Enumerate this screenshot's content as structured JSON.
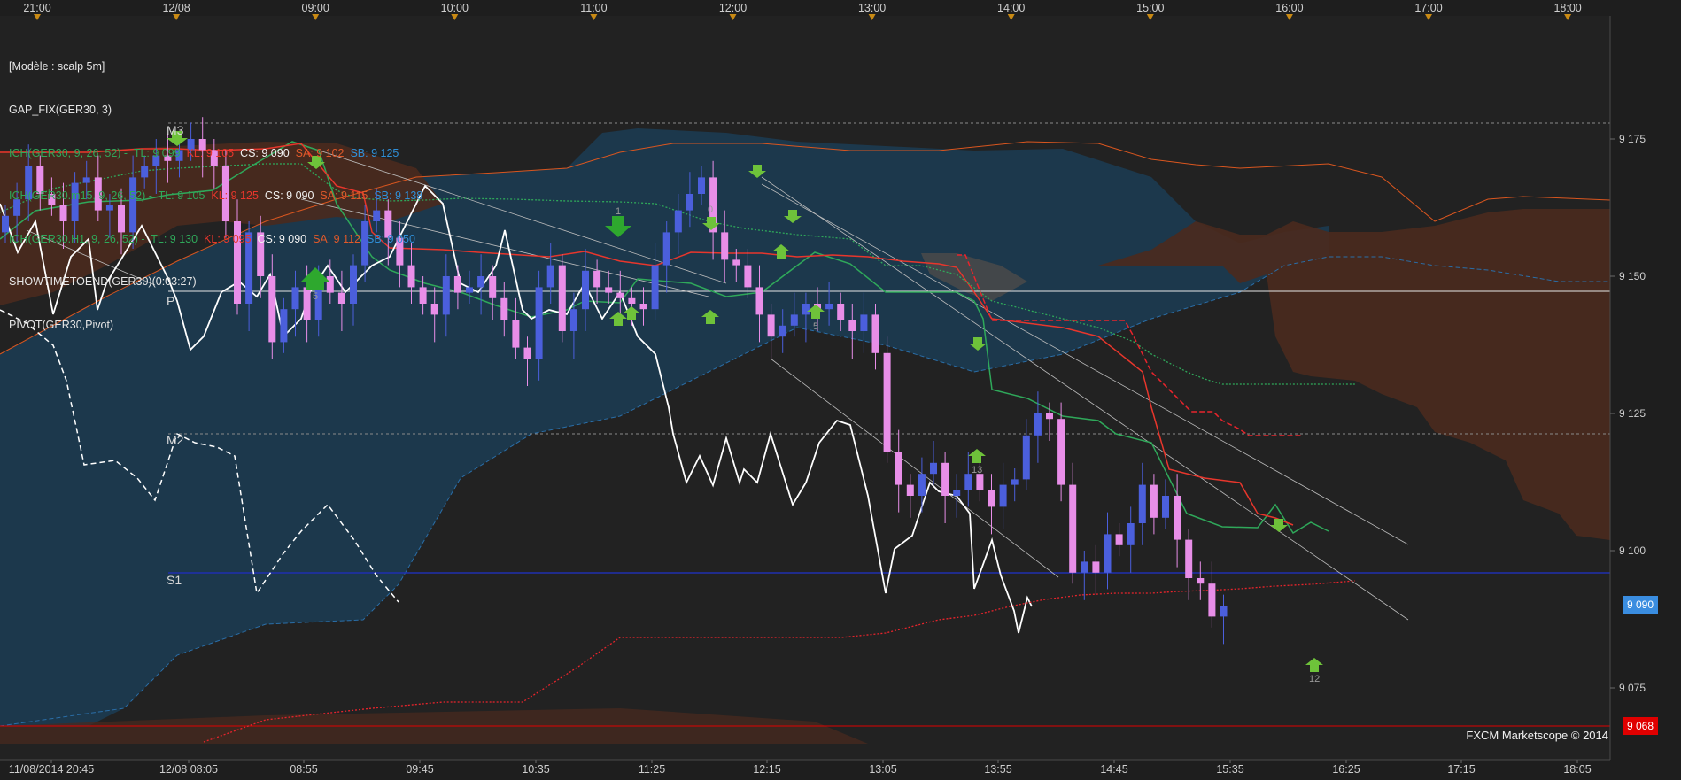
{
  "legend": {
    "model": "[Modèle : scalp 5m]",
    "gap_fix": "GAP_FIX(GER30, 3)",
    "ich1": {
      "name": "ICH(GER30, 9, 26, 52) - ",
      "tl": "TL: 9 099",
      "kl": "KL: 9 105",
      "cs": "CS: 9 090",
      "sa": "SA: 9 102",
      "sb": "SB: 9 125"
    },
    "ich2": {
      "name": "ICH(GER30.m15, 9, 26, 52) - ",
      "tl": "TL: 9 105",
      "kl": "KL: 9 125",
      "cs": "CS: 9 090",
      "sa": "SA: 9 115",
      "sb": "SB: 9 138"
    },
    "ich3": {
      "name": "ICH(GER30.H1, 9, 26, 52) - ",
      "tl": "TL: 9 130",
      "kl": "KL: 9 095",
      "cs": "CS: 9 090",
      "sa": "SA: 9 112",
      "sb": "SB: 9 050"
    },
    "showtime": "SHOWTIMETOEND(GER30)(0:03:27)",
    "pivot": "PIVOT(GER30,Pivot)"
  },
  "credit": "FXCM Marketscope © 2014",
  "price_tags": {
    "current": "9 090",
    "low": "9 068"
  },
  "colors": {
    "background": "#1e1e1e",
    "up_candle": "#4b5fdc",
    "down_candle": "#e88ee8",
    "cloud_blue": "#1c3a4f",
    "cloud_brown": "#4a2a1e",
    "tenkan": "#e8362c",
    "kijun": "#2fa85a",
    "chikou": "#ffffff",
    "pivot": "#ffffff",
    "support": "#1f2fb0",
    "price_current": "#3a8de0",
    "price_low": "#e00000"
  },
  "chart_data": {
    "type": "candlestick",
    "top_time_labels": [
      "21:00",
      "12/08",
      "09:00",
      "10:00",
      "11:00",
      "12:00",
      "13:00",
      "14:00",
      "15:00",
      "16:00",
      "17:00",
      "18:00"
    ],
    "bottom_time_labels": [
      "11/08/2014 20:45",
      "12/08 08:05",
      "08:55",
      "09:45",
      "10:35",
      "11:25",
      "12:15",
      "13:05",
      "13:55",
      "14:45",
      "15:35",
      "16:25",
      "17:15",
      "18:05"
    ],
    "y_ticks": [
      9175,
      9150,
      9125,
      9100,
      9075
    ],
    "y_tick_labels": [
      "9 175",
      "9 150",
      "9 125",
      "9 100",
      "9 075"
    ],
    "levels": [
      {
        "label": "M3",
        "value": 9178
      },
      {
        "label": "P",
        "value": 9147
      },
      {
        "label": "M2",
        "value": 9121
      },
      {
        "label": "S1",
        "value": 9095
      }
    ],
    "annotations": [
      "5",
      "1",
      "0",
      "5",
      "13",
      "12"
    ],
    "closes": [
      9161,
      9164,
      9170,
      9165,
      9163,
      9160,
      9167,
      9168,
      9162,
      9163,
      9158,
      9168,
      9170,
      9172,
      9171,
      9173,
      9175,
      9173,
      9170,
      9160,
      9145,
      9158,
      9150,
      9138,
      9144,
      9148,
      9142,
      9150,
      9147,
      9145,
      9152,
      9160,
      9162,
      9157,
      9152,
      9148,
      9145,
      9143,
      9150,
      9147,
      9148,
      9150,
      9146,
      9142,
      9137,
      9135,
      9148,
      9152,
      9140,
      9144,
      9151,
      9148,
      9147,
      9146,
      9145,
      9144,
      9152,
      9158,
      9162,
      9165,
      9168,
      9158,
      9153,
      9152,
      9148,
      9143,
      9139,
      9141,
      9143,
      9145,
      9144,
      9145,
      9142,
      9140,
      9143,
      9136,
      9118,
      9112,
      9110,
      9114,
      9116,
      9110,
      9111,
      9114,
      9111,
      9108,
      9112,
      9113,
      9121,
      9125,
      9124,
      9112,
      9096,
      9098,
      9096,
      9103,
      9101,
      9105,
      9112,
      9106,
      9110,
      9102,
      9095,
      9094,
      9088,
      9090
    ]
  }
}
